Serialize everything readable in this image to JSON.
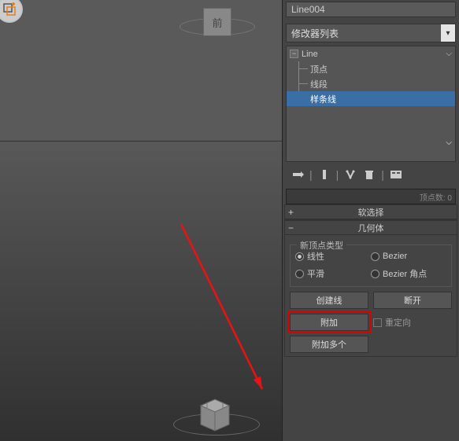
{
  "viewport": {
    "front_label": "前"
  },
  "object_name": "Line004",
  "modifier_dropdown": "修改器列表",
  "stack": {
    "root": "Line",
    "sub1": "顶点",
    "sub2": "线段",
    "sub3": "样条线"
  },
  "faded_text": "顶点数: 0",
  "rollout_soft": "软选择",
  "rollout_geom": "几何体",
  "vertex_type": {
    "group_title": "新顶点类型",
    "r1": "线性",
    "r2": "Bezier",
    "r3": "平滑",
    "r4": "Bezier 角点"
  },
  "buttons": {
    "create_line": "创建线",
    "break": "断开",
    "attach": "附加",
    "attach_mult": "附加多个"
  },
  "reorient": "重定向"
}
